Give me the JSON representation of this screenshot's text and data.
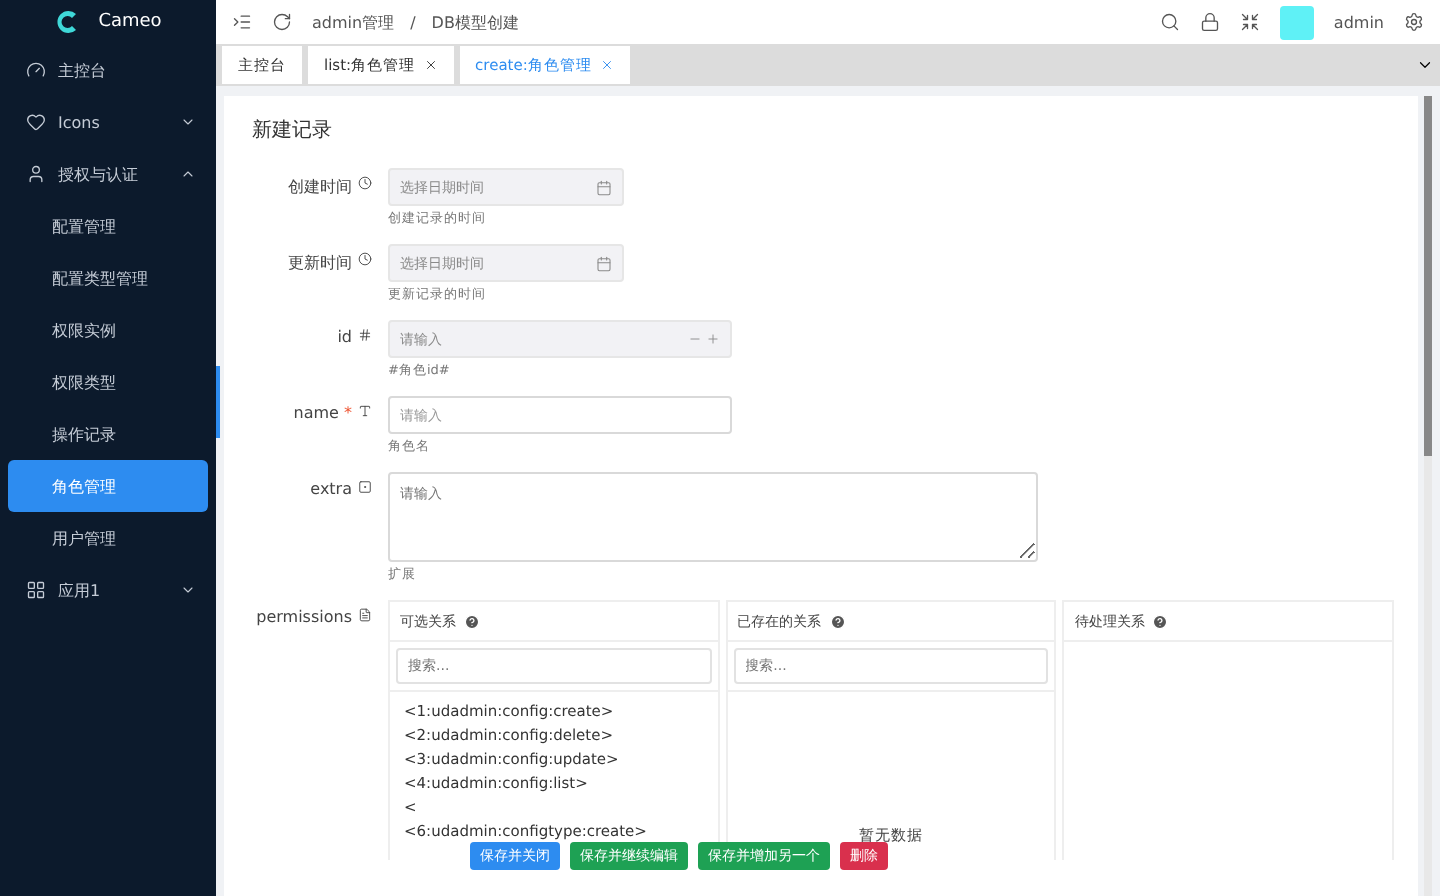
{
  "brand": {
    "name": "Cameo"
  },
  "sidebar": {
    "items": [
      {
        "label": "主控台",
        "selected": false
      },
      {
        "label": "Icons",
        "expanded": false,
        "selected": false
      },
      {
        "label": "授权与认证",
        "expanded": true,
        "selected": false,
        "children": [
          {
            "label": "配置管理",
            "selected": false
          },
          {
            "label": "配置类型管理",
            "selected": false
          },
          {
            "label": "权限实例",
            "selected": false
          },
          {
            "label": "权限类型",
            "selected": false
          },
          {
            "label": "操作记录",
            "selected": false
          },
          {
            "label": "角色管理",
            "selected": true
          },
          {
            "label": "用户管理",
            "selected": false
          }
        ]
      },
      {
        "label": "应用1",
        "expanded": false,
        "selected": false
      }
    ]
  },
  "breadcrumb": {
    "separator": "/",
    "items": [
      "admin管理",
      "DB模型创建"
    ]
  },
  "user": {
    "name": "admin"
  },
  "tabs": [
    {
      "label": "主控台",
      "closable": false,
      "selected": false
    },
    {
      "label": "list:角色管理",
      "closable": true,
      "selected": false
    },
    {
      "label": "create:角色管理",
      "closable": true,
      "selected": true
    }
  ],
  "form": {
    "title": "新建记录",
    "required_mark": "*",
    "fields": [
      {
        "kind": "date",
        "label": "创建时间",
        "required": false,
        "disabled": true,
        "placeholder": "选择日期时间",
        "help": "创建记录的时间"
      },
      {
        "kind": "date",
        "label": "更新时间",
        "required": false,
        "disabled": true,
        "placeholder": "选择日期时间",
        "help": "更新记录的时间"
      },
      {
        "kind": "number",
        "label": "id",
        "required": false,
        "disabled": true,
        "placeholder": "请输入",
        "help": "#角色id#"
      },
      {
        "kind": "text",
        "label": "name",
        "required": true,
        "disabled": false,
        "placeholder": "请输入",
        "help": "角色名"
      },
      {
        "kind": "textarea",
        "label": "extra",
        "required": false,
        "disabled": false,
        "placeholder": "请输入",
        "help": "扩展"
      }
    ],
    "permissions": {
      "label": "permissions",
      "columns": [
        {
          "title": "可选关系",
          "search_placeholder": "搜索...",
          "items": [
            "<1:udadmin:config:create>",
            "<2:udadmin:config:delete>",
            "<3:udadmin:config:update>",
            "<4:udadmin:config:list>",
            "<",
            "<6:udadmin:configtype:create>"
          ]
        },
        {
          "title": "已存在的关系",
          "search_placeholder": "搜索...",
          "empty": "暂无数据"
        },
        {
          "title": "待处理关系"
        }
      ]
    }
  },
  "actions": [
    {
      "label": "保存并关闭",
      "kind": "primary"
    },
    {
      "label": "保存并继续编辑",
      "kind": "success"
    },
    {
      "label": "保存并增加另一个",
      "kind": "success"
    },
    {
      "label": "删除",
      "kind": "danger"
    }
  ]
}
